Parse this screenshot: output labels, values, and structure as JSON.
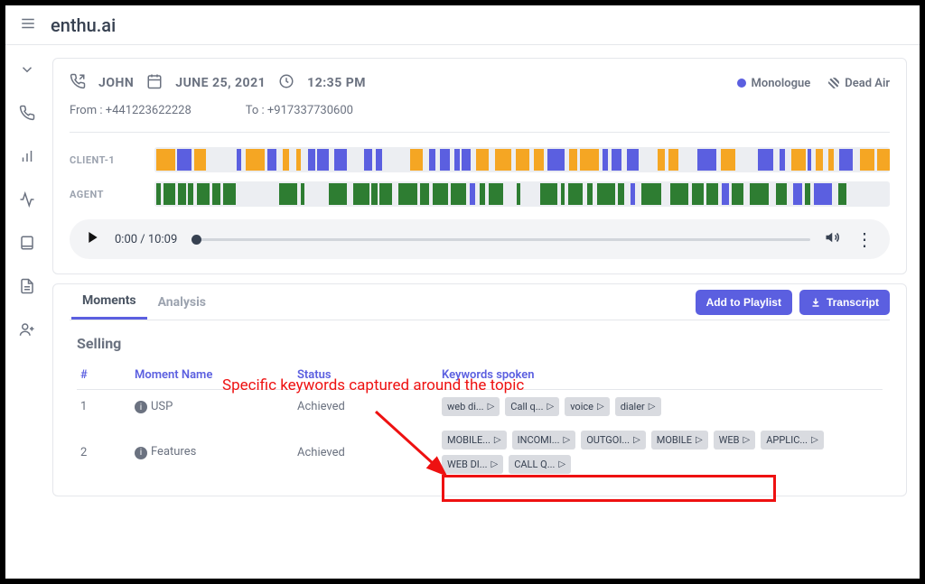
{
  "brand": "enthu.ai",
  "call": {
    "name": "JOHN",
    "date": "JUNE 25, 2021",
    "time": "12:35 PM",
    "from_label": "From : +441223622228",
    "to_label": "To : +917337730600"
  },
  "legend": {
    "monologue": "Monologue",
    "dead_air": "Dead Air",
    "color": "#5b5fe0"
  },
  "tracks": {
    "client": "CLIENT-1",
    "agent": "AGENT"
  },
  "audio": {
    "time": "0:00 / 10:09"
  },
  "tabs": {
    "moments": "Moments",
    "analysis": "Analysis"
  },
  "buttons": {
    "add_playlist": "Add to Playlist",
    "transcript": "Transcript"
  },
  "section": {
    "title": "Selling",
    "headers": {
      "num": "#",
      "name": "Moment Name",
      "status": "Status",
      "keywords": "Keywords spoken"
    },
    "rows": [
      {
        "num": "1",
        "name": "USP",
        "status": "Achieved",
        "chips": [
          "web di...",
          "Call q...",
          "voice",
          "dialer"
        ]
      },
      {
        "num": "2",
        "name": "Features",
        "status": "Achieved",
        "chips": [
          "MOBILE...",
          "INCOMI...",
          "OUTGOI...",
          "MOBILE",
          "WEB",
          "APPLIC...",
          "WEB DI...",
          "CALL Q..."
        ]
      }
    ]
  },
  "annotation": {
    "text": "Specific keywords captured around the topic"
  }
}
